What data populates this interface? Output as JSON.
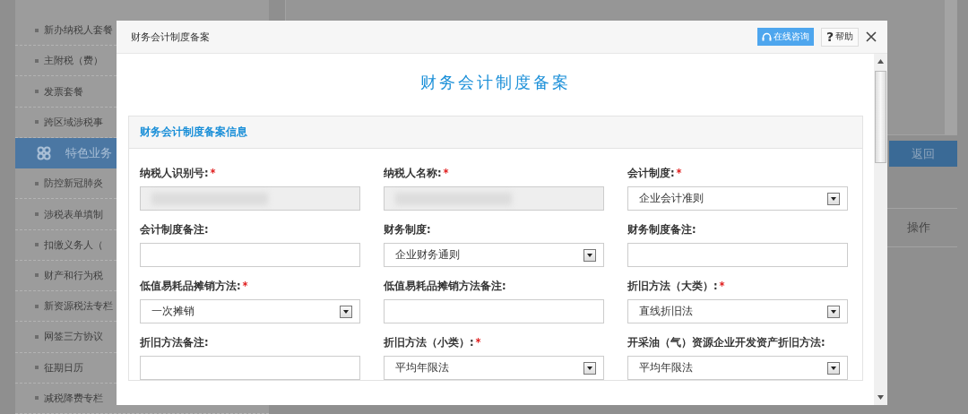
{
  "sidebar": {
    "items": [
      {
        "label": "新办纳税人套餐",
        "kind": "item",
        "selected": false
      },
      {
        "label": "主附税（费）",
        "kind": "item",
        "selected": false
      },
      {
        "label": "发票套餐",
        "kind": "item",
        "selected": false
      },
      {
        "label": "跨区域涉税事",
        "kind": "item",
        "selected": false
      },
      {
        "label": "特色业务",
        "kind": "group",
        "selected": true
      },
      {
        "label": "防控新冠肺炎",
        "kind": "item",
        "selected": false
      },
      {
        "label": "涉税表单填制",
        "kind": "item",
        "selected": false
      },
      {
        "label": "扣缴义务人（",
        "kind": "item",
        "selected": false
      },
      {
        "label": "财产和行为税",
        "kind": "item",
        "selected": false
      },
      {
        "label": "新资源税法专栏",
        "kind": "item",
        "selected": false
      },
      {
        "label": "网签三方协议",
        "kind": "item",
        "selected": false
      },
      {
        "label": "征期日历",
        "kind": "item",
        "selected": false
      },
      {
        "label": "减税降费专栏",
        "kind": "item",
        "selected": false
      }
    ]
  },
  "background": {
    "return_button": "返回",
    "table": {
      "columns": [
        "操作"
      ]
    }
  },
  "dialog": {
    "title": "财务会计制度备案",
    "consult_button": "在线咨询",
    "help_icon": "?",
    "help_button": "帮助",
    "heading": "财务会计制度备案",
    "section": {
      "title": "财务会计制度备案信息",
      "fields": [
        {
          "label": "纳税人识别号:",
          "mark": "*",
          "kind": "masked"
        },
        {
          "label": "纳税人名称:",
          "mark": "*",
          "kind": "masked"
        },
        {
          "label": "会计制度:",
          "mark": "*",
          "kind": "select",
          "value": "企业会计准则"
        },
        {
          "label": "会计制度备注:",
          "kind": "text"
        },
        {
          "label": "财务制度:",
          "kind": "select",
          "value": "企业财务通则"
        },
        {
          "label": "财务制度备注:",
          "kind": "text"
        },
        {
          "label": "低值易耗品摊销方法:",
          "mark": "*",
          "kind": "select",
          "value": "一次摊销"
        },
        {
          "label": "低值易耗品摊销方法备注:",
          "kind": "text"
        },
        {
          "label": "折旧方法（大类）:",
          "mark": "*",
          "kind": "select",
          "value": "直线折旧法"
        },
        {
          "label": "折旧方法备注:",
          "kind": "text"
        },
        {
          "label": "折旧方法（小类）:",
          "mark": "*",
          "kind": "select",
          "value": "平均年限法"
        },
        {
          "label": "开采油（气）资源企业开发资产折旧方法:",
          "kind": "select",
          "value": "平均年限法"
        }
      ]
    }
  }
}
